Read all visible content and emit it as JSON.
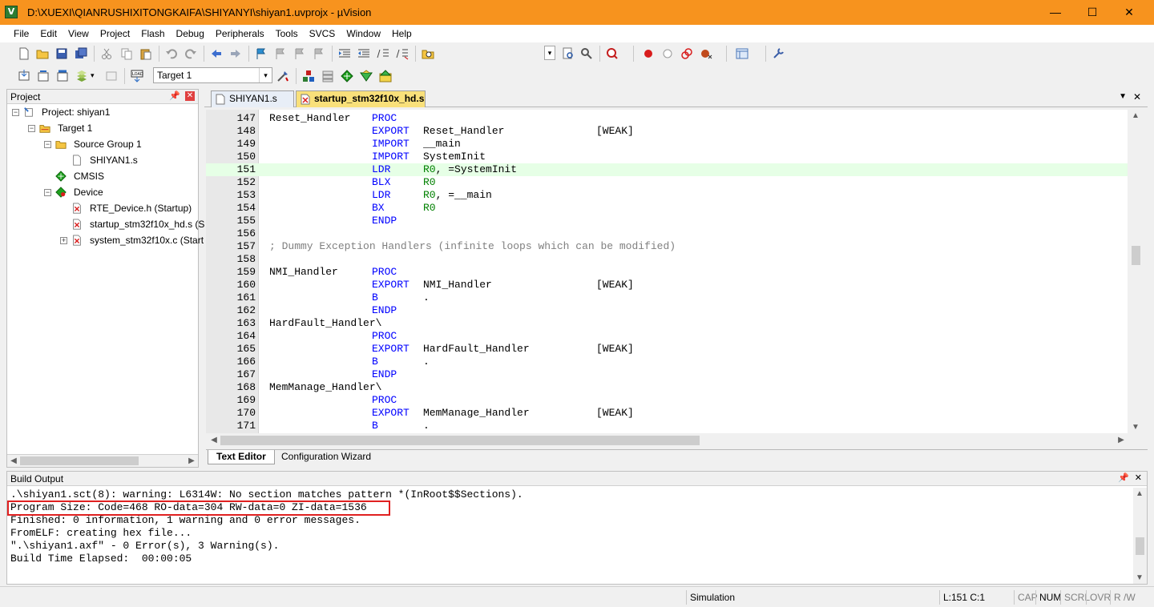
{
  "window": {
    "title": "D:\\XUEXI\\QIANRUSHIXITONGKAIFA\\SHIYANYI\\shiyan1.uvprojx - µVision",
    "app_icon": "V",
    "minimize": "—",
    "maximize": "☐",
    "close": "✕"
  },
  "menu": [
    "File",
    "Edit",
    "View",
    "Project",
    "Flash",
    "Debug",
    "Peripherals",
    "Tools",
    "SVCS",
    "Window",
    "Help"
  ],
  "toolbar2": {
    "target": "Target 1",
    "dropdown_arrow": "▾"
  },
  "project_panel": {
    "title": "Project",
    "pin": "📌",
    "close": "✕",
    "tree": [
      {
        "label": "Project: shiyan1",
        "icon": "project-icon"
      },
      {
        "label": "Target 1",
        "icon": "target-icon"
      },
      {
        "label": "Source Group 1",
        "icon": "folder-icon"
      },
      {
        "label": "SHIYAN1.s",
        "icon": "file-icon"
      },
      {
        "label": "CMSIS",
        "icon": "cmsis-icon"
      },
      {
        "label": "Device",
        "icon": "device-icon"
      },
      {
        "label": "RTE_Device.h (Startup)",
        "icon": "locked-file-icon"
      },
      {
        "label": "startup_stm32f10x_hd.s (S",
        "icon": "locked-file-icon"
      },
      {
        "label": "system_stm32f10x.c (Start",
        "icon": "locked-file-icon"
      }
    ],
    "toggles": {
      "expanded": "−",
      "collapsed": "+"
    }
  },
  "editor": {
    "tabs": [
      {
        "label": "SHIYAN1.s",
        "active": false
      },
      {
        "label": "startup_stm32f10x_hd.s",
        "active": true
      }
    ],
    "tab_menu": "▼",
    "tab_close": "✕",
    "highlight_line": 151,
    "lines": [
      {
        "n": "147",
        "label": "Reset_Handler",
        "op": "PROC",
        "arg": "",
        "extra": ""
      },
      {
        "n": "148",
        "label": "",
        "op": "EXPORT",
        "arg": "Reset_Handler",
        "extra": "[WEAK]"
      },
      {
        "n": "149",
        "label": "",
        "op": "IMPORT",
        "arg": "__main",
        "extra": ""
      },
      {
        "n": "150",
        "label": "",
        "op": "IMPORT",
        "arg": "SystemInit",
        "extra": ""
      },
      {
        "n": "151",
        "label": "",
        "op": "LDR",
        "arg": "R0, =SystemInit",
        "extra": ""
      },
      {
        "n": "152",
        "label": "",
        "op": "BLX",
        "arg": "R0",
        "extra": ""
      },
      {
        "n": "153",
        "label": "",
        "op": "LDR",
        "arg": "R0, =__main",
        "extra": ""
      },
      {
        "n": "154",
        "label": "",
        "op": "BX",
        "arg": "R0",
        "extra": ""
      },
      {
        "n": "155",
        "label": "",
        "op": "ENDP",
        "arg": "",
        "extra": ""
      },
      {
        "n": "156",
        "label": "",
        "op": "",
        "arg": "",
        "extra": ""
      },
      {
        "n": "157",
        "comment": "; Dummy Exception Handlers (infinite loops which can be modified)"
      },
      {
        "n": "158",
        "label": "",
        "op": "",
        "arg": "",
        "extra": ""
      },
      {
        "n": "159",
        "label": "NMI_Handler",
        "op": "PROC",
        "arg": "",
        "extra": ""
      },
      {
        "n": "160",
        "label": "",
        "op": "EXPORT",
        "arg": "NMI_Handler",
        "extra": "[WEAK]"
      },
      {
        "n": "161",
        "label": "",
        "op": "B",
        "arg": ".",
        "extra": ""
      },
      {
        "n": "162",
        "label": "",
        "op": "ENDP",
        "arg": "",
        "extra": ""
      },
      {
        "n": "163",
        "label": "HardFault_Handler\\",
        "op": "",
        "arg": "",
        "extra": ""
      },
      {
        "n": "164",
        "label": "",
        "op": "PROC",
        "arg": "",
        "extra": ""
      },
      {
        "n": "165",
        "label": "",
        "op": "EXPORT",
        "arg": "HardFault_Handler",
        "extra": "[WEAK]"
      },
      {
        "n": "166",
        "label": "",
        "op": "B",
        "arg": ".",
        "extra": ""
      },
      {
        "n": "167",
        "label": "",
        "op": "ENDP",
        "arg": "",
        "extra": ""
      },
      {
        "n": "168",
        "label": "MemManage_Handler\\",
        "op": "",
        "arg": "",
        "extra": ""
      },
      {
        "n": "169",
        "label": "",
        "op": "PROC",
        "arg": "",
        "extra": ""
      },
      {
        "n": "170",
        "label": "",
        "op": "EXPORT",
        "arg": "MemManage_Handler",
        "extra": "[WEAK]"
      },
      {
        "n": "171",
        "label": "",
        "op": "B",
        "arg": ".",
        "extra": ""
      }
    ],
    "bottom_tabs": [
      "Text Editor",
      "Configuration Wizard"
    ]
  },
  "build_output": {
    "title": "Build Output",
    "pin": "📌",
    "close": "✕",
    "lines": [
      ".\\shiyan1.sct(8): warning: L6314W: No section matches pattern *(InRoot$$Sections).",
      "Program Size: Code=468 RO-data=304 RW-data=0 ZI-data=1536",
      "Finished: 0 information, 1 warning and 0 error messages.",
      "FromELF: creating hex file...",
      "\".\\shiyan1.axf\" - 0 Error(s), 3 Warning(s).",
      "Build Time Elapsed:  00:00:05"
    ],
    "highlighted_line_index": 1
  },
  "status": {
    "mode": "Simulation",
    "position": "L:151 C:1",
    "cap": "CAP",
    "num": "NUM",
    "scrl": "SCRL",
    "ovr": "OVR",
    "rw": "R /W"
  },
  "colors": {
    "titlebar": "#f7931e",
    "keyword": "#0000ff",
    "register": "#008000",
    "comment": "#808080",
    "highlight_line": "#e6ffe6",
    "annotation_box": "#e02020"
  }
}
